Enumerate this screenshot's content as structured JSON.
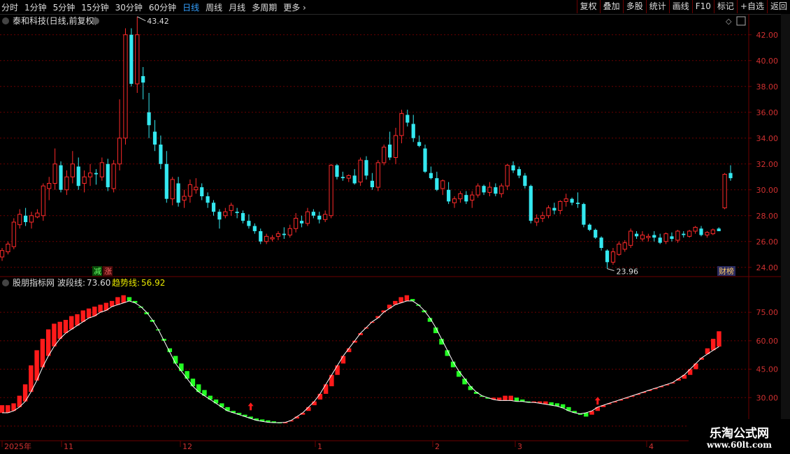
{
  "toolbar": {
    "periods": [
      "分时",
      "1分钟",
      "5分钟",
      "15分钟",
      "30分钟",
      "60分钟",
      "日线",
      "周线",
      "月线",
      "多周期",
      "更多"
    ],
    "active_period": "日线",
    "buttons": [
      "复权",
      "叠加",
      "多股",
      "统计",
      "画线",
      "F10",
      "标记",
      "+自选",
      "返回"
    ]
  },
  "colors": {
    "up": "#ff2a2a",
    "down": "#34e8f0",
    "grid": "#6b0000",
    "ind_red": "#ff1a1a",
    "ind_green": "#22ff22",
    "accent": "#33a0ff",
    "trend_label": "#e8e800"
  },
  "price_panel": {
    "title": "泰和科技(日线,前复权)",
    "y_ticks": [
      "42.00",
      "40.00",
      "38.00",
      "36.00",
      "34.00",
      "32.00",
      "30.00",
      "28.00",
      "26.00",
      "24.00"
    ],
    "high_label": "43.42",
    "low_label": "23.96",
    "tag_left_1": "减",
    "tag_left_2": "涨",
    "tag_right": "财榜"
  },
  "indicator_panel": {
    "name": "股朋指标网",
    "wave_label": "波段线:",
    "wave_value": "73.60",
    "trend_label": "趋势线:",
    "trend_value": "56.92",
    "y_ticks": [
      "75.00",
      "60.00",
      "45.00",
      "30.00",
      "15.00"
    ]
  },
  "x_axis": {
    "labels": [
      "2025年",
      "11",
      "12",
      "1",
      "2",
      "3",
      "4"
    ]
  },
  "chart_data": [
    {
      "type": "candlestick",
      "title": "泰和科技(日线,前复权)",
      "ylim": [
        23.5,
        43.5
      ],
      "ohlc": [
        [
          24.8,
          25.5,
          24.5,
          25.3
        ],
        [
          25.2,
          26.0,
          25.0,
          25.8
        ],
        [
          25.6,
          27.8,
          25.4,
          27.5
        ],
        [
          27.3,
          28.5,
          27.0,
          28.1
        ],
        [
          28.0,
          28.6,
          27.2,
          27.5
        ],
        [
          27.5,
          28.3,
          27.0,
          28.0
        ],
        [
          27.9,
          28.5,
          27.8,
          28.2
        ],
        [
          28.0,
          30.5,
          27.6,
          30.3
        ],
        [
          30.1,
          31.0,
          29.2,
          30.5
        ],
        [
          30.5,
          33.2,
          30.0,
          32.0
        ],
        [
          31.9,
          32.2,
          29.8,
          30.0
        ],
        [
          30.0,
          31.5,
          29.6,
          31.0
        ],
        [
          31.0,
          33.0,
          30.5,
          32.0
        ],
        [
          31.8,
          32.5,
          30.0,
          30.3
        ],
        [
          30.5,
          31.5,
          29.8,
          31.0
        ],
        [
          31.0,
          32.0,
          30.3,
          31.3
        ],
        [
          31.3,
          31.6,
          30.4,
          31.2
        ],
        [
          31.0,
          32.5,
          30.7,
          32.1
        ],
        [
          32.0,
          32.4,
          29.9,
          30.2
        ],
        [
          30.1,
          32.3,
          29.8,
          32.0
        ],
        [
          32.0,
          37.0,
          31.5,
          34.0
        ],
        [
          34.0,
          42.5,
          33.5,
          42.0
        ],
        [
          42.0,
          42.5,
          38.0,
          38.2
        ],
        [
          38.2,
          43.4,
          37.5,
          42.0
        ],
        [
          38.8,
          39.5,
          37.0,
          38.3
        ],
        [
          36.0,
          37.5,
          34.0,
          35.0
        ],
        [
          34.5,
          35.4,
          33.0,
          33.5
        ],
        [
          33.5,
          34.2,
          31.6,
          32.0
        ],
        [
          32.0,
          33.0,
          29.0,
          29.3
        ],
        [
          29.3,
          31.0,
          28.8,
          30.8
        ],
        [
          30.5,
          31.0,
          28.7,
          29.0
        ],
        [
          29.2,
          30.0,
          28.6,
          29.5
        ],
        [
          29.5,
          30.8,
          29.0,
          30.4
        ],
        [
          30.0,
          30.9,
          29.7,
          30.2
        ],
        [
          30.2,
          30.5,
          29.2,
          29.5
        ],
        [
          29.5,
          29.8,
          28.6,
          29.0
        ],
        [
          29.0,
          29.2,
          28.0,
          28.3
        ],
        [
          28.3,
          28.5,
          27.0,
          27.7
        ],
        [
          28.0,
          28.6,
          27.8,
          28.3
        ],
        [
          28.4,
          29.0,
          28.0,
          28.8
        ],
        [
          28.3,
          28.6,
          27.8,
          28.2
        ],
        [
          28.2,
          28.4,
          27.4,
          27.6
        ],
        [
          27.6,
          28.1,
          27.0,
          27.2
        ],
        [
          27.2,
          27.4,
          26.6,
          26.8
        ],
        [
          26.8,
          27.0,
          25.8,
          26.0
        ],
        [
          26.0,
          26.6,
          25.8,
          26.4
        ],
        [
          26.2,
          26.5,
          26.0,
          26.3
        ],
        [
          26.4,
          26.8,
          26.1,
          26.6
        ],
        [
          26.6,
          27.1,
          26.2,
          26.5
        ],
        [
          26.5,
          27.3,
          26.3,
          27.0
        ],
        [
          27.0,
          28.2,
          26.7,
          27.8
        ],
        [
          27.6,
          28.0,
          27.1,
          27.4
        ],
        [
          27.4,
          28.6,
          27.2,
          28.3
        ],
        [
          28.3,
          28.5,
          27.8,
          28.0
        ],
        [
          28.0,
          28.3,
          27.4,
          27.7
        ],
        [
          27.7,
          28.4,
          27.5,
          28.1
        ],
        [
          28.0,
          32.0,
          27.8,
          31.9
        ],
        [
          31.9,
          32.0,
          30.8,
          31.0
        ],
        [
          31.0,
          31.4,
          30.7,
          30.9
        ],
        [
          30.9,
          31.2,
          30.6,
          31.1
        ],
        [
          31.1,
          31.6,
          30.4,
          30.5
        ],
        [
          30.6,
          32.5,
          30.3,
          32.3
        ],
        [
          32.3,
          32.6,
          30.8,
          31.1
        ],
        [
          30.7,
          31.3,
          30.0,
          30.2
        ],
        [
          30.2,
          32.3,
          29.9,
          32.1
        ],
        [
          32.1,
          33.5,
          31.9,
          33.3
        ],
        [
          33.5,
          34.5,
          32.3,
          32.5
        ],
        [
          32.5,
          34.8,
          32.0,
          34.2
        ],
        [
          34.2,
          36.2,
          33.6,
          35.9
        ],
        [
          35.8,
          36.2,
          34.9,
          35.2
        ],
        [
          35.1,
          35.8,
          33.7,
          34.0
        ],
        [
          33.7,
          34.2,
          33.3,
          33.4
        ],
        [
          33.2,
          33.5,
          31.3,
          31.4
        ],
        [
          31.3,
          31.8,
          30.8,
          30.9
        ],
        [
          30.9,
          31.4,
          29.9,
          30.0
        ],
        [
          30.1,
          30.8,
          29.6,
          30.7
        ],
        [
          30.0,
          30.6,
          28.9,
          29.1
        ],
        [
          29.0,
          29.5,
          28.6,
          29.3
        ],
        [
          29.3,
          29.9,
          29.0,
          29.7
        ],
        [
          29.6,
          29.9,
          28.9,
          29.1
        ],
        [
          29.2,
          29.9,
          28.6,
          29.6
        ],
        [
          29.6,
          30.5,
          29.4,
          30.3
        ],
        [
          30.3,
          30.4,
          29.6,
          29.8
        ],
        [
          29.8,
          30.6,
          29.5,
          30.2
        ],
        [
          30.2,
          30.5,
          29.5,
          29.7
        ],
        [
          29.7,
          30.5,
          29.4,
          30.3
        ],
        [
          30.3,
          32.0,
          30.0,
          31.9
        ],
        [
          31.9,
          32.2,
          31.3,
          31.5
        ],
        [
          31.6,
          31.8,
          30.9,
          31.1
        ],
        [
          31.1,
          31.3,
          30.1,
          30.3
        ],
        [
          30.3,
          30.4,
          27.4,
          27.6
        ],
        [
          27.5,
          28.1,
          27.2,
          27.8
        ],
        [
          27.8,
          28.3,
          27.5,
          28.0
        ],
        [
          28.0,
          28.8,
          27.8,
          28.6
        ],
        [
          28.6,
          29.0,
          28.1,
          28.4
        ],
        [
          28.4,
          29.2,
          28.1,
          29.1
        ],
        [
          29.1,
          29.7,
          28.7,
          29.3
        ],
        [
          29.3,
          29.4,
          28.8,
          29.0
        ],
        [
          29.0,
          29.8,
          28.6,
          28.9
        ],
        [
          28.9,
          29.0,
          27.1,
          27.3
        ],
        [
          27.3,
          27.4,
          26.8,
          26.9
        ],
        [
          26.9,
          27.0,
          26.2,
          26.3
        ],
        [
          26.3,
          26.4,
          25.3,
          25.5
        ],
        [
          25.3,
          25.4,
          23.9,
          24.4
        ],
        [
          24.4,
          25.5,
          24.2,
          25.2
        ],
        [
          25.0,
          26.0,
          24.9,
          25.8
        ],
        [
          25.4,
          26.1,
          25.2,
          25.9
        ],
        [
          25.7,
          27.0,
          25.5,
          26.8
        ],
        [
          26.6,
          26.8,
          26.2,
          26.4
        ],
        [
          26.2,
          26.8,
          26.0,
          26.5
        ],
        [
          26.3,
          26.6,
          26.0,
          26.4
        ],
        [
          26.5,
          26.8,
          26.0,
          26.3
        ],
        [
          26.3,
          26.6,
          25.8,
          25.9
        ],
        [
          26.0,
          26.7,
          25.8,
          26.6
        ],
        [
          26.4,
          26.7,
          26.0,
          26.2
        ],
        [
          26.1,
          26.9,
          25.9,
          26.8
        ],
        [
          26.6,
          26.8,
          26.3,
          26.5
        ],
        [
          26.4,
          26.9,
          26.3,
          26.8
        ],
        [
          26.8,
          27.2,
          26.6,
          27.1
        ],
        [
          27.0,
          27.2,
          26.4,
          26.5
        ],
        [
          26.5,
          26.8,
          26.3,
          26.7
        ],
        [
          26.6,
          27.0,
          26.5,
          26.9
        ],
        [
          27.0,
          27.1,
          26.8,
          26.8
        ],
        [
          28.6,
          31.3,
          28.5,
          31.2
        ],
        [
          31.3,
          31.9,
          30.7,
          30.9
        ]
      ]
    },
    {
      "type": "area",
      "title": "股朋指标网",
      "ylim": [
        15,
        85
      ],
      "series": [
        {
          "name": "波段线",
          "values": [
            26,
            26,
            27,
            31,
            37,
            47,
            55,
            61,
            66,
            69,
            70,
            71,
            73,
            74,
            76,
            77,
            78,
            79,
            80,
            81,
            83,
            84,
            83,
            81,
            78,
            74,
            70,
            66,
            61,
            56,
            52,
            48,
            44,
            40,
            37,
            34,
            31,
            29,
            27,
            25,
            23,
            22,
            21,
            20,
            19,
            18.5,
            18,
            17.5,
            17,
            17,
            18,
            19,
            21,
            23,
            26,
            29,
            32,
            36,
            42,
            48,
            54,
            59,
            63,
            67,
            70,
            73,
            76,
            79,
            81,
            83,
            84,
            82,
            79,
            75,
            70,
            64,
            58,
            52,
            46,
            41,
            37,
            34,
            32,
            31,
            30,
            30,
            30,
            31,
            31,
            30,
            29,
            28,
            28,
            28,
            28,
            27.5,
            27,
            26.5,
            25,
            23,
            21,
            20,
            21,
            23,
            25,
            27,
            28,
            29,
            30,
            31,
            32,
            33,
            34,
            35,
            36,
            37,
            38,
            39,
            40,
            42,
            45,
            50,
            56,
            61,
            65,
            69,
            73.6
          ]
        },
        {
          "name": "趋势线",
          "values": [
            22,
            22,
            23,
            25,
            28,
            33,
            39,
            46,
            52,
            57,
            61,
            64,
            66,
            68,
            70,
            72,
            73,
            75,
            76,
            78,
            79,
            80,
            81,
            80,
            78,
            75,
            71,
            66,
            60,
            54,
            48,
            44,
            40,
            36,
            33,
            31,
            29,
            27,
            25,
            23,
            22,
            21,
            20,
            19,
            18,
            17.5,
            17,
            16.8,
            16.8,
            17,
            18,
            20,
            22,
            25,
            28,
            32,
            37,
            42,
            47,
            52,
            56,
            60,
            64,
            67,
            70,
            72,
            75,
            77,
            79,
            80,
            81,
            81,
            79,
            76,
            72,
            67,
            61,
            55,
            49,
            44,
            40,
            36,
            33,
            31,
            30,
            29,
            28.5,
            28.5,
            28.5,
            28,
            28,
            27.5,
            27.5,
            27,
            26.5,
            26,
            25.5,
            24.5,
            23,
            22,
            21.5,
            22,
            23,
            25,
            26,
            27,
            28,
            29,
            30,
            31,
            32,
            33,
            34,
            35,
            36,
            37,
            38,
            40,
            42,
            45,
            48,
            51,
            53,
            55,
            56.92
          ]
        }
      ]
    }
  ]
}
